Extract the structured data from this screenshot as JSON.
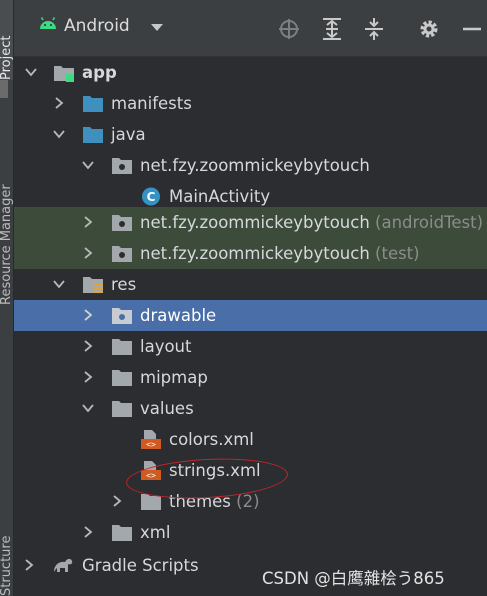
{
  "side_tabs": {
    "project": "Project",
    "resource_manager": "Resource Manager",
    "structure": "Structure"
  },
  "toolbar": {
    "view_selector": "Android",
    "icons": [
      "android-icon",
      "chevron-down-icon",
      "locate-icon",
      "expand-all-icon",
      "collapse-all-icon",
      "gear-icon",
      "minimize-icon"
    ]
  },
  "tree": [
    {
      "label": "app",
      "expanded": true,
      "icon": "module-folder-icon"
    },
    {
      "label": "manifests",
      "expanded": false,
      "icon": "folder-icon"
    },
    {
      "label": "java",
      "expanded": true,
      "icon": "folder-icon"
    },
    {
      "label": "net.fzy.zoommickeybytouch",
      "expanded": true,
      "icon": "package-icon"
    },
    {
      "label": "MainActivity",
      "icon": "class-icon"
    },
    {
      "label": "net.fzy.zoommickeybytouch",
      "suffix": "(androidTest)",
      "expanded": false,
      "icon": "package-icon"
    },
    {
      "label": "net.fzy.zoommickeybytouch",
      "suffix": "(test)",
      "expanded": false,
      "icon": "package-icon"
    },
    {
      "label": "res",
      "expanded": true,
      "icon": "res-folder-icon"
    },
    {
      "label": "drawable",
      "expanded": false,
      "icon": "folder-icon",
      "selected": true
    },
    {
      "label": "layout",
      "expanded": false,
      "icon": "folder-icon"
    },
    {
      "label": "mipmap",
      "expanded": false,
      "icon": "folder-icon"
    },
    {
      "label": "values",
      "expanded": true,
      "icon": "folder-icon"
    },
    {
      "label": "colors.xml",
      "icon": "xml-file-icon"
    },
    {
      "label": "strings.xml",
      "icon": "xml-file-icon",
      "highlighted": true
    },
    {
      "label": "themes",
      "suffix": "(2)",
      "expanded": false,
      "icon": "folder-icon"
    },
    {
      "label": "xml",
      "expanded": false,
      "icon": "folder-icon"
    },
    {
      "label": "Gradle Scripts",
      "expanded": false,
      "icon": "gradle-icon"
    }
  ],
  "watermark": "CSDN @白鹰雜桧う865",
  "colors": {
    "background": "#2b2d30",
    "selection": "#4a6ea8",
    "test_row": "#3d4b3b",
    "annotation": "#c0262b"
  }
}
